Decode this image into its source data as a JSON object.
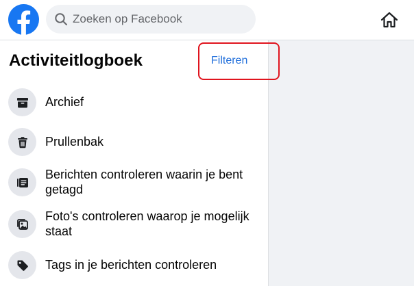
{
  "header": {
    "search": {
      "placeholder": "Zoeken op Facebook",
      "value": ""
    },
    "logo_icon": "facebook-logo",
    "home_icon": "home-icon",
    "brand_color": "#1877f2"
  },
  "main": {
    "title": "Activiteitlogboek",
    "filter_label": "Filteren",
    "highlight_color": "#e0141e",
    "link_color": "#216fdb"
  },
  "menu": {
    "items": [
      {
        "label": "Archief",
        "icon": "archive-icon"
      },
      {
        "label": "Prullenbak",
        "icon": "trash-icon"
      },
      {
        "label": "Berichten controleren waarin je bent getagd",
        "icon": "tagged-posts-icon"
      },
      {
        "label": "Foto's controleren waarop je mogelijk staat",
        "icon": "photo-review-icon"
      },
      {
        "label": "Tags in je berichten controleren",
        "icon": "tag-icon"
      }
    ]
  }
}
